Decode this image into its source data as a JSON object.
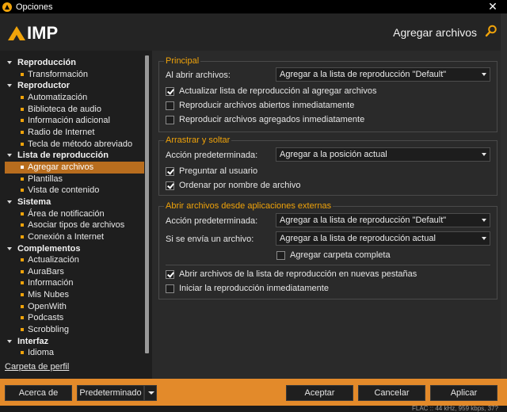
{
  "window": {
    "title": "Opciones",
    "close_glyph": "✕"
  },
  "header": {
    "logo_text": "IMP",
    "page_title": "Agregar archivos",
    "search_icon": "search-icon",
    "accent": "#f0a30a"
  },
  "sidebar": {
    "groups": [
      {
        "label": "Reproducción",
        "children": [
          "Transformación"
        ]
      },
      {
        "label": "Reproductor",
        "children": [
          "Automatización",
          "Biblioteca de audio",
          "Información adicional",
          "Radio de Internet",
          "Tecla de método abreviado"
        ]
      },
      {
        "label": "Lista de reproducción",
        "children": [
          "Agregar archivos",
          "Plantillas",
          "Vista de contenido"
        ]
      },
      {
        "label": "Sistema",
        "children": [
          "Área de notificación",
          "Asociar tipos de archivos",
          "Conexión a Internet"
        ]
      },
      {
        "label": "Complementos",
        "children": [
          "Actualización",
          "AuraBars",
          "Información",
          "Mis Nubes",
          "OpenWith",
          "Podcasts",
          "Scrobbling"
        ]
      },
      {
        "label": "Interfaz",
        "children": [
          "Idioma"
        ]
      }
    ],
    "selected": "Agregar archivos",
    "profile_link": "Carpeta de perfil"
  },
  "main": {
    "principal": {
      "legend": "Principal",
      "on_open_label": "Al abrir archivos:",
      "on_open_value": "Agregar a la lista de reproducción \"Default\"",
      "options": [
        {
          "label": "Actualizar lista de reproducción al agregar archivos",
          "checked": true
        },
        {
          "label": "Reproducir archivos abiertos inmediatamente",
          "checked": false
        },
        {
          "label": "Reproducir archivos agregados inmediatamente",
          "checked": false
        }
      ]
    },
    "drag": {
      "legend": "Arrastrar y soltar",
      "default_action_label": "Acción predeterminada:",
      "default_action_value": "Agregar a la posición actual",
      "options": [
        {
          "label": "Preguntar al usuario",
          "checked": true
        },
        {
          "label": "Ordenar por nombre de archivo",
          "checked": true
        }
      ]
    },
    "external": {
      "legend": "Abrir archivos desde aplicaciones externas",
      "default_action_label": "Acción predeterminada:",
      "default_action_value": "Agregar a la lista de reproducción \"Default\"",
      "single_file_label": "Si se envía un archivo:",
      "single_file_value": "Agregar a la lista de reproducción actual",
      "add_folder": {
        "label": "Agregar carpeta completa",
        "checked": false
      },
      "options": [
        {
          "label": "Abrir archivos de la lista de reproducción en nuevas pestañas",
          "checked": true
        },
        {
          "label": "Iniciar la reproducción inmediatamente",
          "checked": false
        }
      ]
    }
  },
  "footer": {
    "about": "Acerca de",
    "defaults": "Predeterminado",
    "accept": "Aceptar",
    "cancel": "Cancelar",
    "apply": "Aplicar"
  },
  "status": {
    "text": "FLAC :: 44 kHz, 959 kbps, 37?"
  }
}
